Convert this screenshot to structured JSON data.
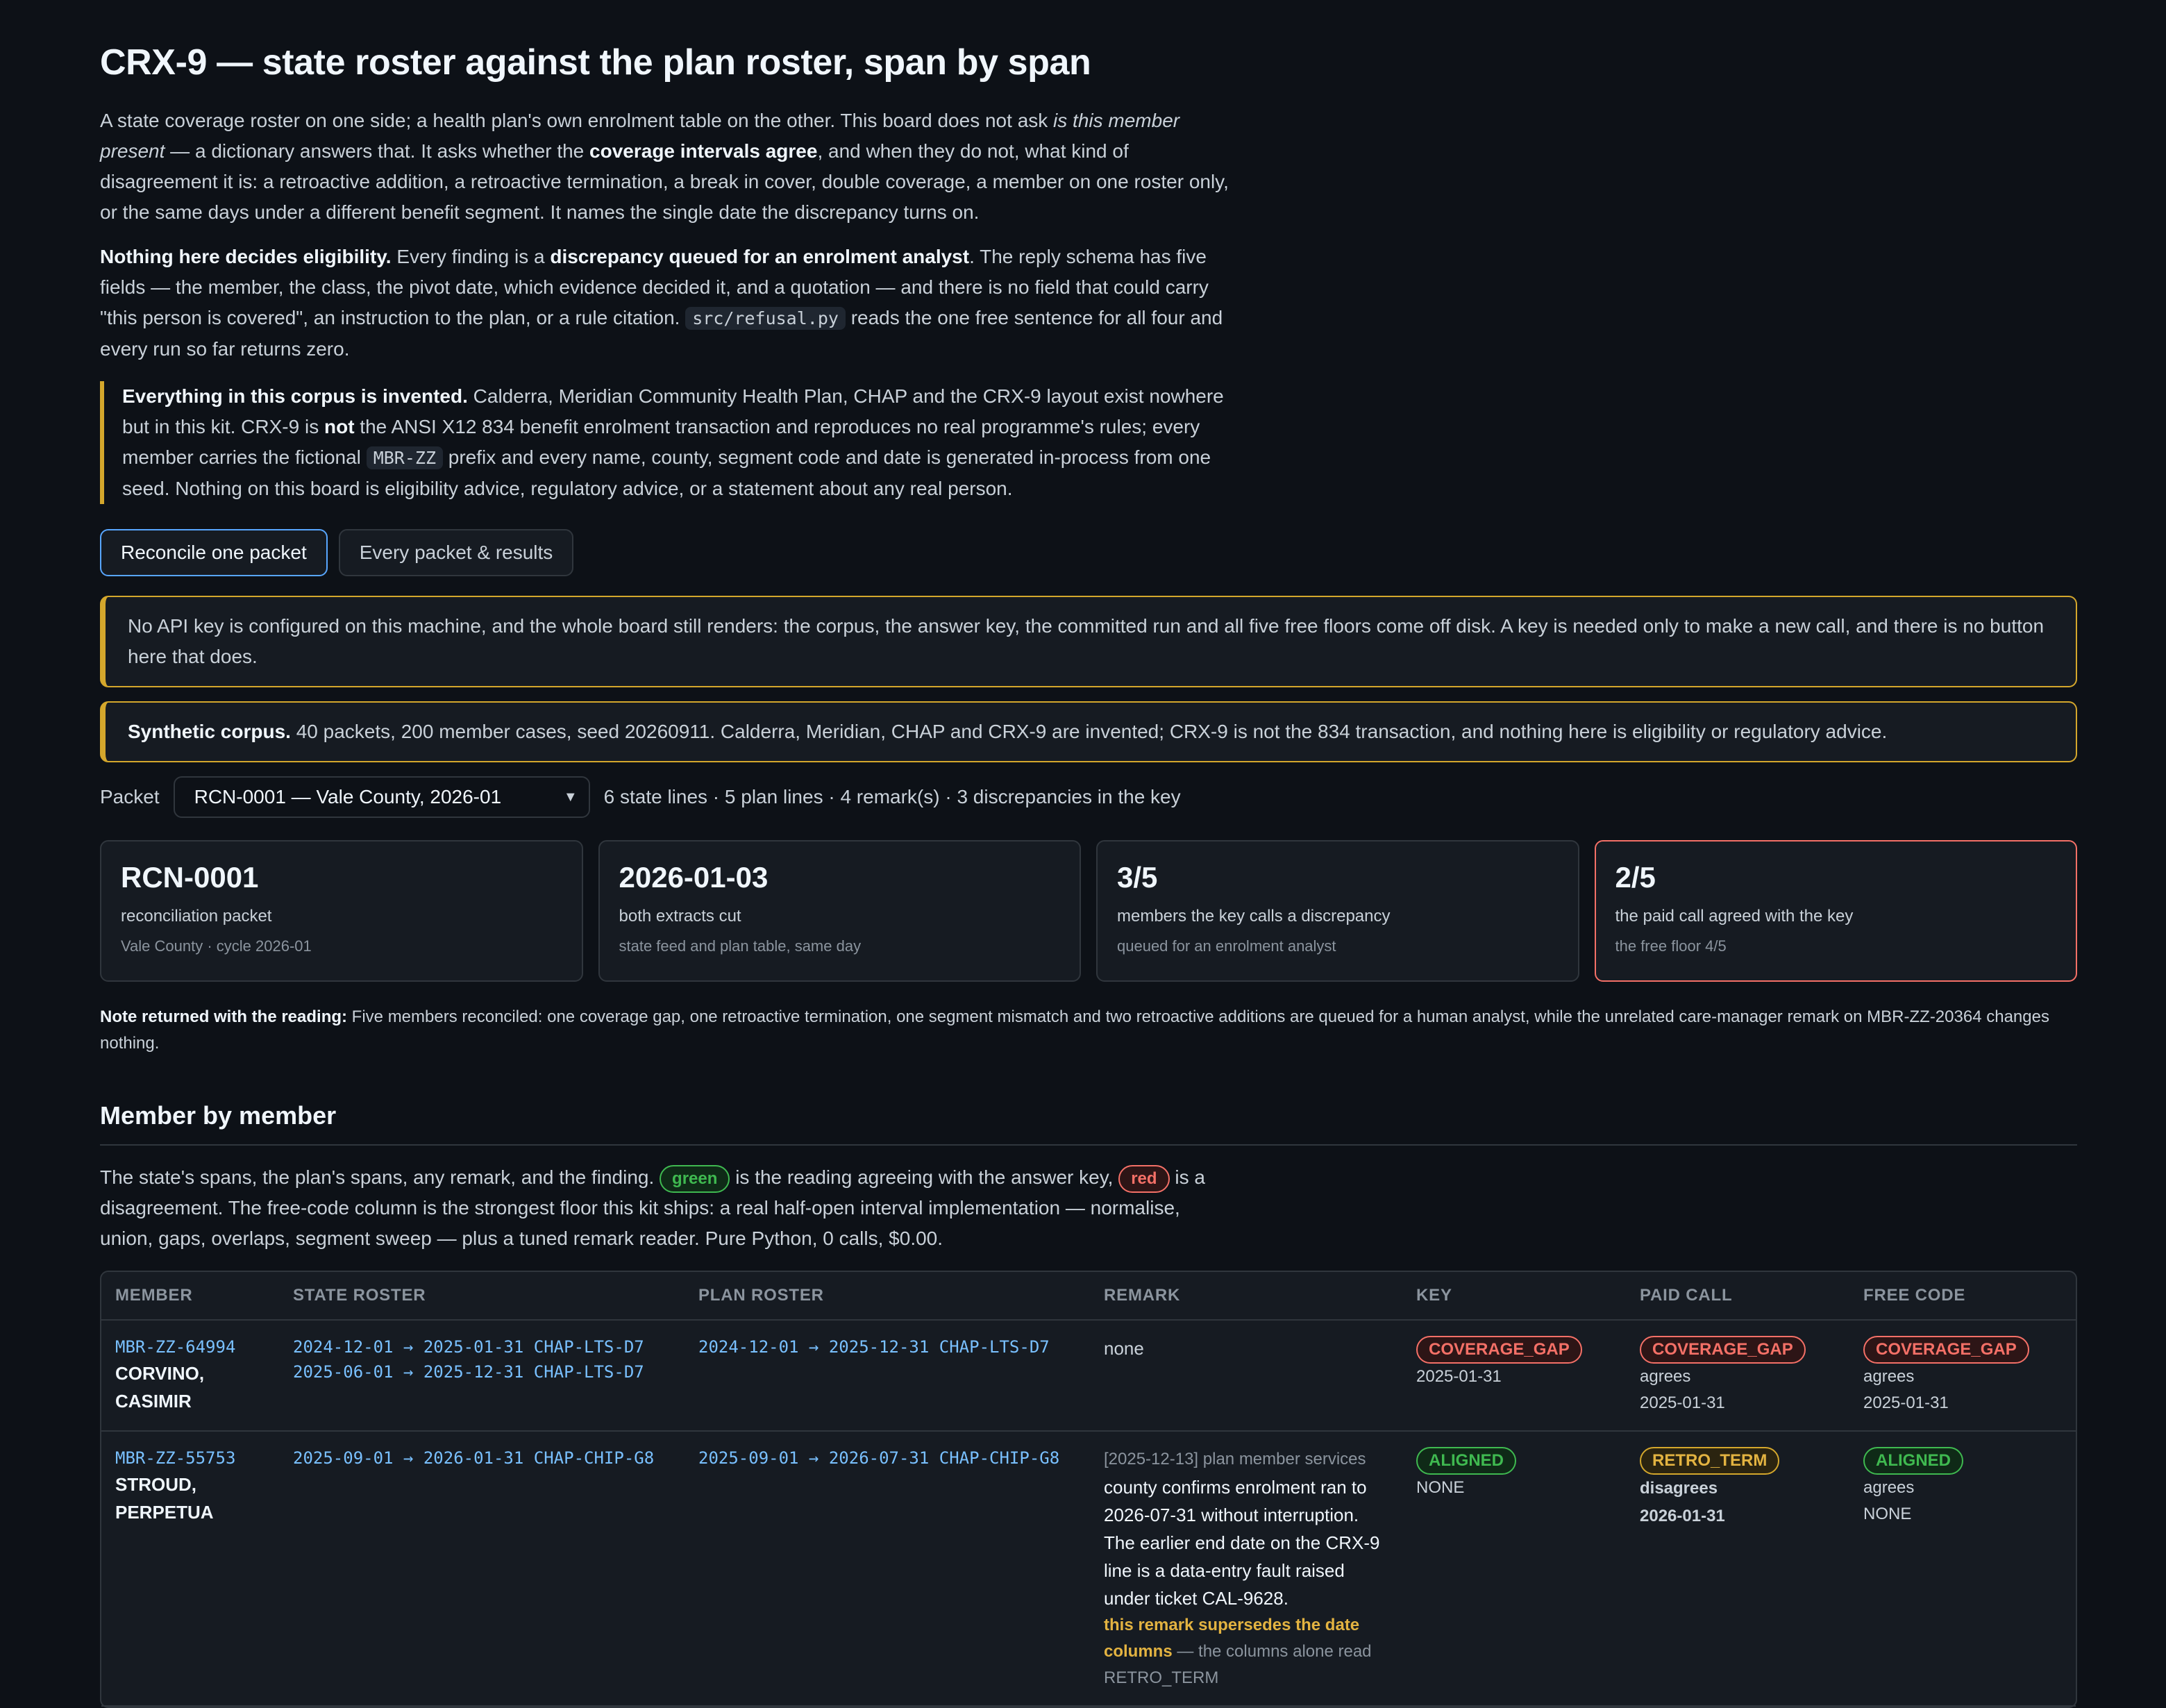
{
  "title": "CRX-9 — state roster against the plan roster, span by span",
  "intro": {
    "p1_a": "A state coverage roster on one side; a health plan's own enrolment table on the other. This board does not ask ",
    "p1_em": "is this member present",
    "p1_b": " — a dictionary answers that. It asks whether the ",
    "p1_strong": "coverage intervals agree",
    "p1_c": ", and when they do not, what kind of disagreement it is: a retroactive addition, a retroactive termination, a break in cover, double coverage, a member on one roster only, or the same days under a different benefit segment. It names the single date the discrepancy turns on.",
    "p2_strong1": "Nothing here decides eligibility.",
    "p2_a": " Every finding is a ",
    "p2_strong2": "discrepancy queued for an enrolment analyst",
    "p2_b": ". The reply schema has five fields — the member, the class, the pivot date, which evidence decided it, and a quotation — and there is no field that could carry \"this person is covered\", an instruction to the plan, or a rule citation. ",
    "p2_code": "src/refusal.py",
    "p2_c": " reads the one free sentence for all four and every run so far returns zero.",
    "q_strong": "Everything in this corpus is invented.",
    "q_a": " Calderra, Meridian Community Health Plan, CHAP and the CRX-9 layout exist nowhere but in this kit. CRX-9 is ",
    "q_not": "not",
    "q_b": " the ANSI X12 834 benefit enrolment transaction and reproduces no real programme's rules; every member carries the fictional ",
    "q_code": "MBR-ZZ",
    "q_c": " prefix and every name, county, segment code and date is generated in-process from one seed. Nothing on this board is eligibility advice, regulatory advice, or a statement about any real person."
  },
  "tabs": [
    {
      "label": "Reconcile one packet",
      "active": true
    },
    {
      "label": "Every packet & results",
      "active": false
    }
  ],
  "banners": {
    "api": "No API key is configured on this machine, and the whole board still renders: the corpus, the answer key, the committed run and all five free floors come off disk. A key is needed only to make a new call, and there is no button here that does.",
    "synthetic_strong": "Synthetic corpus.",
    "synthetic_text": " 40 packets, 200 member cases, seed 20260911. Calderra, Meridian, CHAP and CRX-9 are invented; CRX-9 is not the 834 transaction, and nothing here is eligibility or regulatory advice."
  },
  "picker": {
    "label": "Packet",
    "selected": "RCN-0001 — Vale County, 2026-01",
    "summary": "6 state lines · 5 plan lines · 4 remark(s) · 3 discrepancies in the key"
  },
  "cards": [
    {
      "big": "RCN-0001",
      "label": "reconciliation packet",
      "sub": "Vale County · cycle 2026-01"
    },
    {
      "big": "2026-01-03",
      "label": "both extracts cut",
      "sub": "state feed and plan table, same day"
    },
    {
      "big": "3/5",
      "label": "members the key calls a discrepancy",
      "sub": "queued for an enrolment analyst"
    },
    {
      "big": "2/5",
      "label": "the paid call agreed with the key",
      "sub": "the free floor 4/5"
    }
  ],
  "note": {
    "strong": "Note returned with the reading:",
    "text": " Five members reconciled: one coverage gap, one retroactive termination, one segment mismatch and two retroactive additions are queued for a human analyst, while the unrelated care-manager remark on MBR-ZZ-20364 changes nothing."
  },
  "section": {
    "title": "Member by member",
    "d_a": "The state's spans, the plan's spans, any remark, and the finding. ",
    "d_green": "green",
    "d_b": " is the reading agreeing with the answer key, ",
    "d_red": "red",
    "d_c": " is a disagreement. The free-code column is the strongest floor this kit ships: a real half-open interval implementation — normalise, union, gaps, overlaps, segment sweep — plus a tuned remark reader. Pure Python, 0 calls, $0.00."
  },
  "table": {
    "headers": [
      "Member",
      "State roster",
      "Plan roster",
      "Remark",
      "Key",
      "Paid call",
      "Free code"
    ],
    "rows": [
      {
        "id": "MBR-ZZ-64994",
        "name": "CORVINO, CASIMIR",
        "state": [
          "2024-12-01 → 2025-01-31 CHAP-LTS-D7",
          "2025-06-01 → 2025-12-31 CHAP-LTS-D7"
        ],
        "plan": [
          "2024-12-01 → 2025-12-31 CHAP-LTS-D7"
        ],
        "remark_none": "none",
        "key": {
          "pill": "COVERAGE_GAP",
          "date": "2025-01-31"
        },
        "paid": {
          "pill": "COVERAGE_GAP",
          "verdict": "agrees",
          "date": "2025-01-31"
        },
        "free": {
          "pill": "COVERAGE_GAP",
          "verdict": "agrees",
          "date": "2025-01-31"
        }
      },
      {
        "id": "MBR-ZZ-55753",
        "name": "STROUD, PERPETUA",
        "state": [
          "2025-09-01 → 2026-01-31 CHAP-CHIP-G8"
        ],
        "plan": [
          "2025-09-01 → 2026-07-31 CHAP-CHIP-G8"
        ],
        "remark_head": "[2025-12-13] plan member services",
        "remark_body": "county confirms enrolment ran to 2026-07-31 without interruption. The earlier end date on the CRX-9 line is a data-entry fault raised under ticket CAL-9628.",
        "remark_flag": "this remark supersedes the date columns",
        "remark_tail": " — the columns alone read RETRO_TERM",
        "key": {
          "pill": "ALIGNED",
          "date": "NONE"
        },
        "paid": {
          "pill": "RETRO_TERM",
          "verdict": "disagrees",
          "date": "2026-01-31"
        },
        "free": {
          "pill": "ALIGNED",
          "verdict": "agrees",
          "date": "NONE"
        }
      }
    ]
  },
  "colors": {
    "accent": "#58a6ff",
    "warn": "#d4a72c",
    "good": "#3fb950",
    "bad": "#f47067",
    "bg": "#0d1117"
  }
}
